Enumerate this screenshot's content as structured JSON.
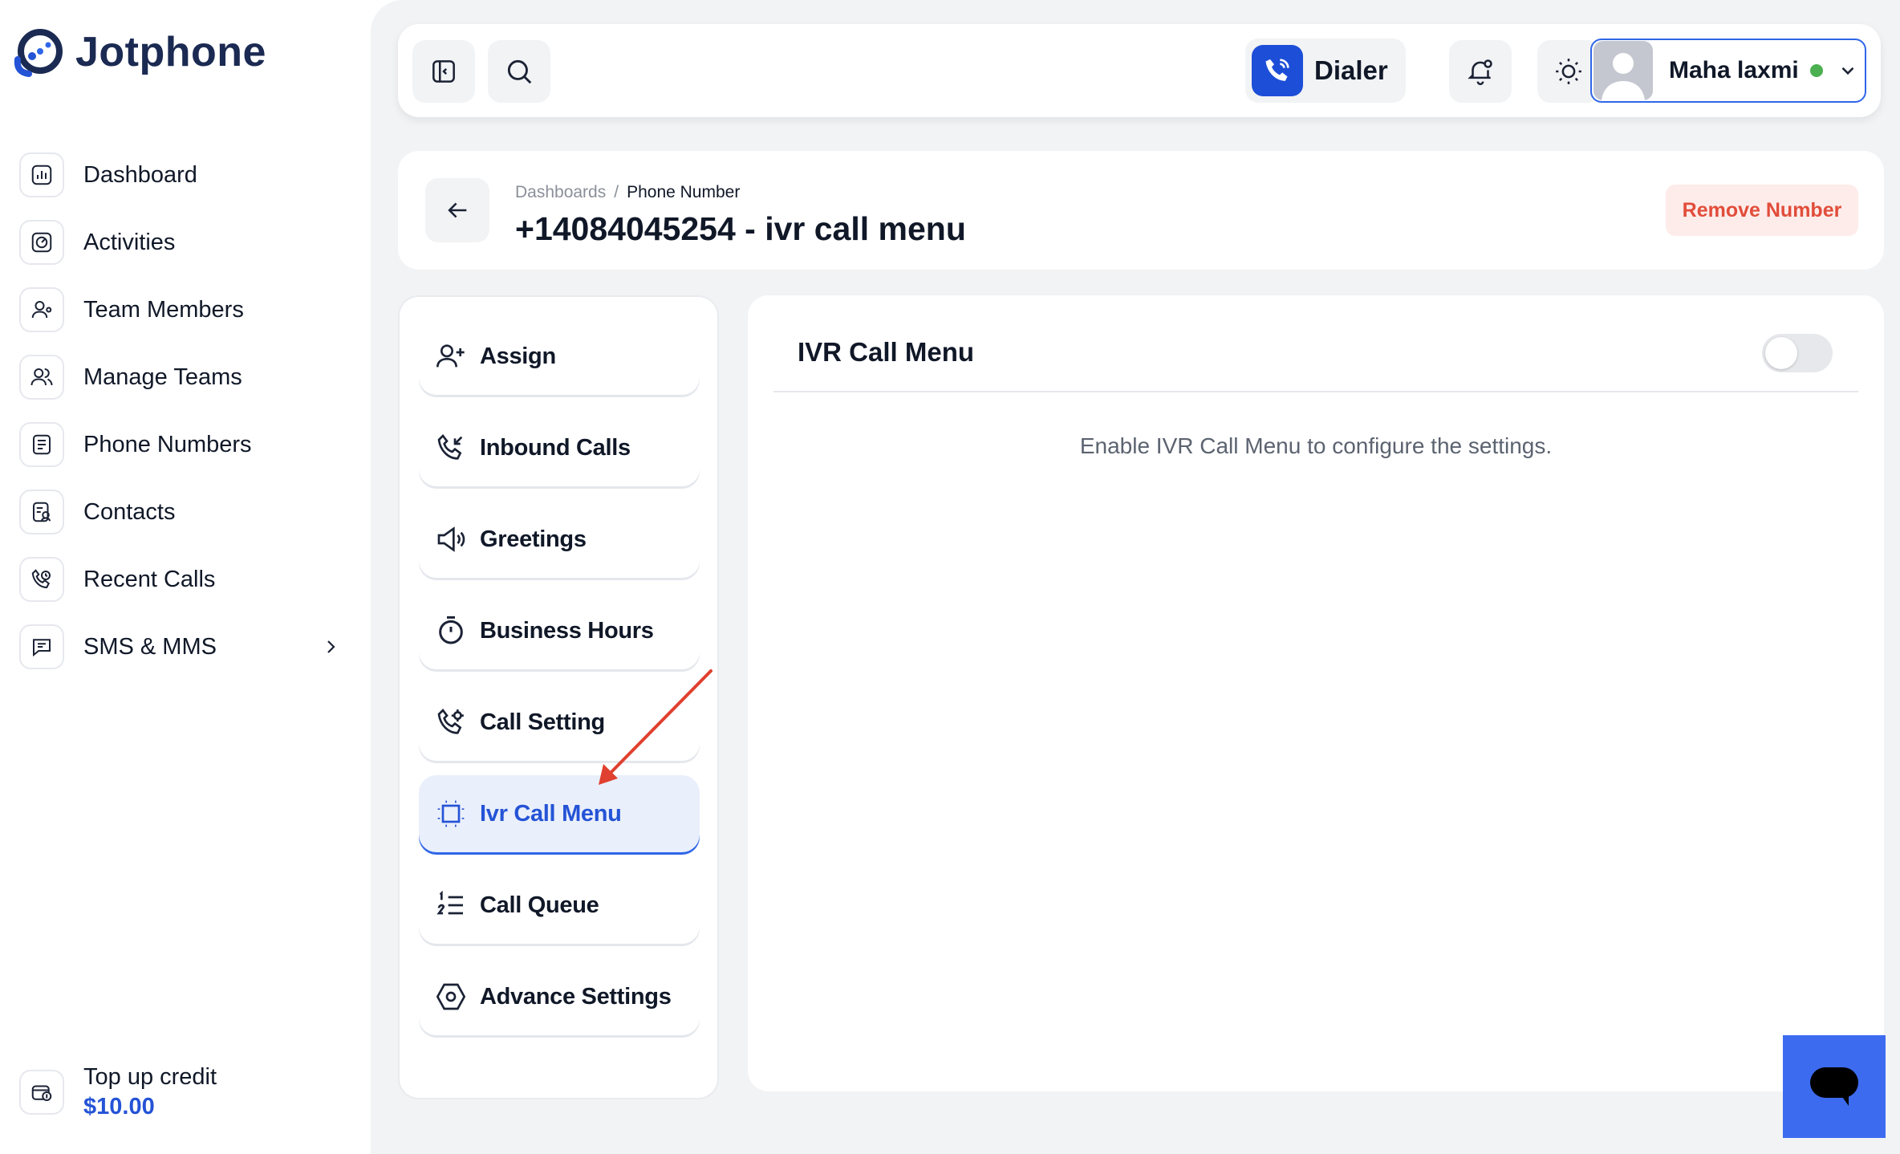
{
  "app": {
    "name": "Jotphone"
  },
  "sidebar": {
    "items": [
      {
        "label": "Dashboard",
        "icon": "dashboard-chart-icon"
      },
      {
        "label": "Activities",
        "icon": "activity-icon"
      },
      {
        "label": "Team Members",
        "icon": "team-members-icon"
      },
      {
        "label": "Manage Teams",
        "icon": "manage-teams-icon"
      },
      {
        "label": "Phone Numbers",
        "icon": "phone-numbers-icon"
      },
      {
        "label": "Contacts",
        "icon": "contacts-icon"
      },
      {
        "label": "Recent Calls",
        "icon": "recent-calls-icon"
      },
      {
        "label": "SMS & MMS",
        "icon": "sms-icon"
      }
    ],
    "topup": {
      "label": "Top up credit",
      "amount": "$10.00"
    }
  },
  "topbar": {
    "dialer_label": "Dialer",
    "user_name": "Maha laxmi",
    "user_status_color": "#4caf50"
  },
  "header": {
    "breadcrumb": [
      "Dashboards",
      "/",
      "Phone Number"
    ],
    "title": "+14084045254 - ivr call menu",
    "remove_label": "Remove Number"
  },
  "settings_menu": {
    "items": [
      {
        "label": "Assign",
        "icon": "assign-user-icon"
      },
      {
        "label": "Inbound Calls",
        "icon": "inbound-call-icon"
      },
      {
        "label": "Greetings",
        "icon": "megaphone-icon"
      },
      {
        "label": "Business Hours",
        "icon": "timer-icon"
      },
      {
        "label": "Call Setting",
        "icon": "call-settings-icon"
      },
      {
        "label": "Ivr Call Menu",
        "icon": "ivr-menu-icon",
        "active": true
      },
      {
        "label": "Call Queue",
        "icon": "numbered-list-icon"
      },
      {
        "label": "Advance Settings",
        "icon": "hexagon-settings-icon"
      }
    ]
  },
  "content": {
    "title": "IVR Call Menu",
    "toggle_enabled": false,
    "hint": "Enable IVR Call Menu to configure the settings."
  },
  "colors": {
    "accent": "#2453d6",
    "danger": "#e14d3a",
    "annotation_arrow": "#e0402f"
  }
}
